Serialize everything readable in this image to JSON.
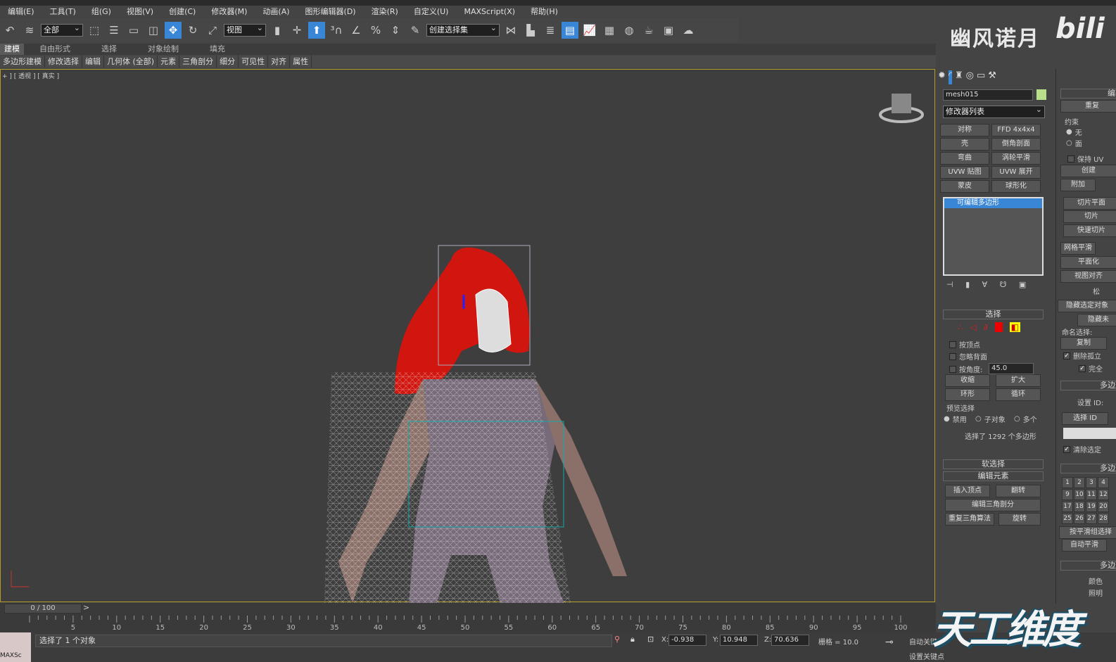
{
  "menu": [
    "编辑(E)",
    "工具(T)",
    "组(G)",
    "视图(V)",
    "创建(C)",
    "修改器(M)",
    "动画(A)",
    "图形编辑器(D)",
    "渲染(R)",
    "自定义(U)",
    "MAXScript(X)",
    "帮助(H)"
  ],
  "toolbar": {
    "filter": "全部",
    "refcoord": "视图",
    "selset": "创建选择集"
  },
  "brand": "幽风诺月",
  "bili_logo": "bili",
  "ribbon_tabs": [
    "建模",
    "自由形式",
    "选择",
    "对象绘制",
    "填充"
  ],
  "subribbon": [
    "多边形建模",
    "修改选择",
    "编辑",
    "几何体 (全部)",
    "元素",
    "三角剖分",
    "细分",
    "可见性",
    "对齐",
    "属性"
  ],
  "viewport": {
    "label": "+ ] [ 透视 ] [ 真实 ]"
  },
  "command": {
    "object_name": "mesh015",
    "object_color": "#b8e08a",
    "modifier_list": "修改器列表",
    "mod_buttons": [
      "对称",
      "FFD 4x4x4",
      "壳",
      "倒角剖面",
      "弯曲",
      "涡轮平滑",
      "UVW 贴图",
      "UVW 展开",
      "蒙皮",
      "球形化"
    ],
    "stack_item": "可编辑多边形",
    "selection": {
      "title": "选择",
      "by_vertex": "按顶点",
      "ignore_backface": "忽略背面",
      "by_angle": "按角度:",
      "angle": "45.0",
      "shrink": "收缩",
      "grow": "扩大",
      "ring": "环形",
      "loop": "循环",
      "preview": "预览选择",
      "disable": "禁用",
      "subobj": "子对象",
      "multi": "多个",
      "status": "选择了 1292 个多边形"
    },
    "soft_selection": "软选择",
    "edit_elements": {
      "title": "编辑元素",
      "insert_vertex": "插入顶点",
      "flip": "翻转",
      "edit_tri": "编辑三角剖分",
      "retri": "重复三角算法",
      "turn": "旋转"
    }
  },
  "command2": {
    "edit_geo": "编辑",
    "repeat": "重复",
    "constraint": "约束",
    "none": "无",
    "face": "面",
    "keep_uv": "保持 UV",
    "create": "创建",
    "attach": "附加",
    "slice_plane": "切片平面",
    "slice": "切片",
    "quickslice": "快速切片",
    "meshsmooth": "网格平滑",
    "planarize": "平面化",
    "view_align": "视图对齐",
    "relax": "松",
    "hide_sel": "隐藏选定对象",
    "hide_unsel": "隐藏未",
    "named_sel": "命名选择:",
    "copy": "复制",
    "delete_iso": "删除孤立",
    "full": "完全",
    "poly_mat": "多边形",
    "set_id": "设置 ID:",
    "select_id": "选择 ID",
    "clear_sel": "清除选定",
    "poly_smooth": "多边形",
    "ids": [
      "1",
      "2",
      "3",
      "4",
      "9",
      "10",
      "11",
      "12",
      "17",
      "18",
      "19",
      "20",
      "25",
      "26",
      "27",
      "28"
    ],
    "by_smooth": "按平滑组选择",
    "auto_smooth": "自动平滑",
    "poly_vc": "多边形",
    "color": "颜色",
    "illum": "照明"
  },
  "timeline": {
    "frame": "0 / 100",
    "ticks": [
      "5",
      "10",
      "15",
      "20",
      "25",
      "30",
      "35",
      "40",
      "45",
      "50",
      "55",
      "60",
      "65",
      "70",
      "75",
      "80",
      "85",
      "90",
      "95",
      "100"
    ]
  },
  "status": {
    "msg": "选择了 1 个对象",
    "x": "-0.938",
    "y": "10.948",
    "z": "70.636",
    "grid": "栅格 = 10.0",
    "autokey": "自动关键点",
    "setkey": "设置关键点",
    "maxscript": "MAXSc"
  },
  "watermark": "天工维度"
}
